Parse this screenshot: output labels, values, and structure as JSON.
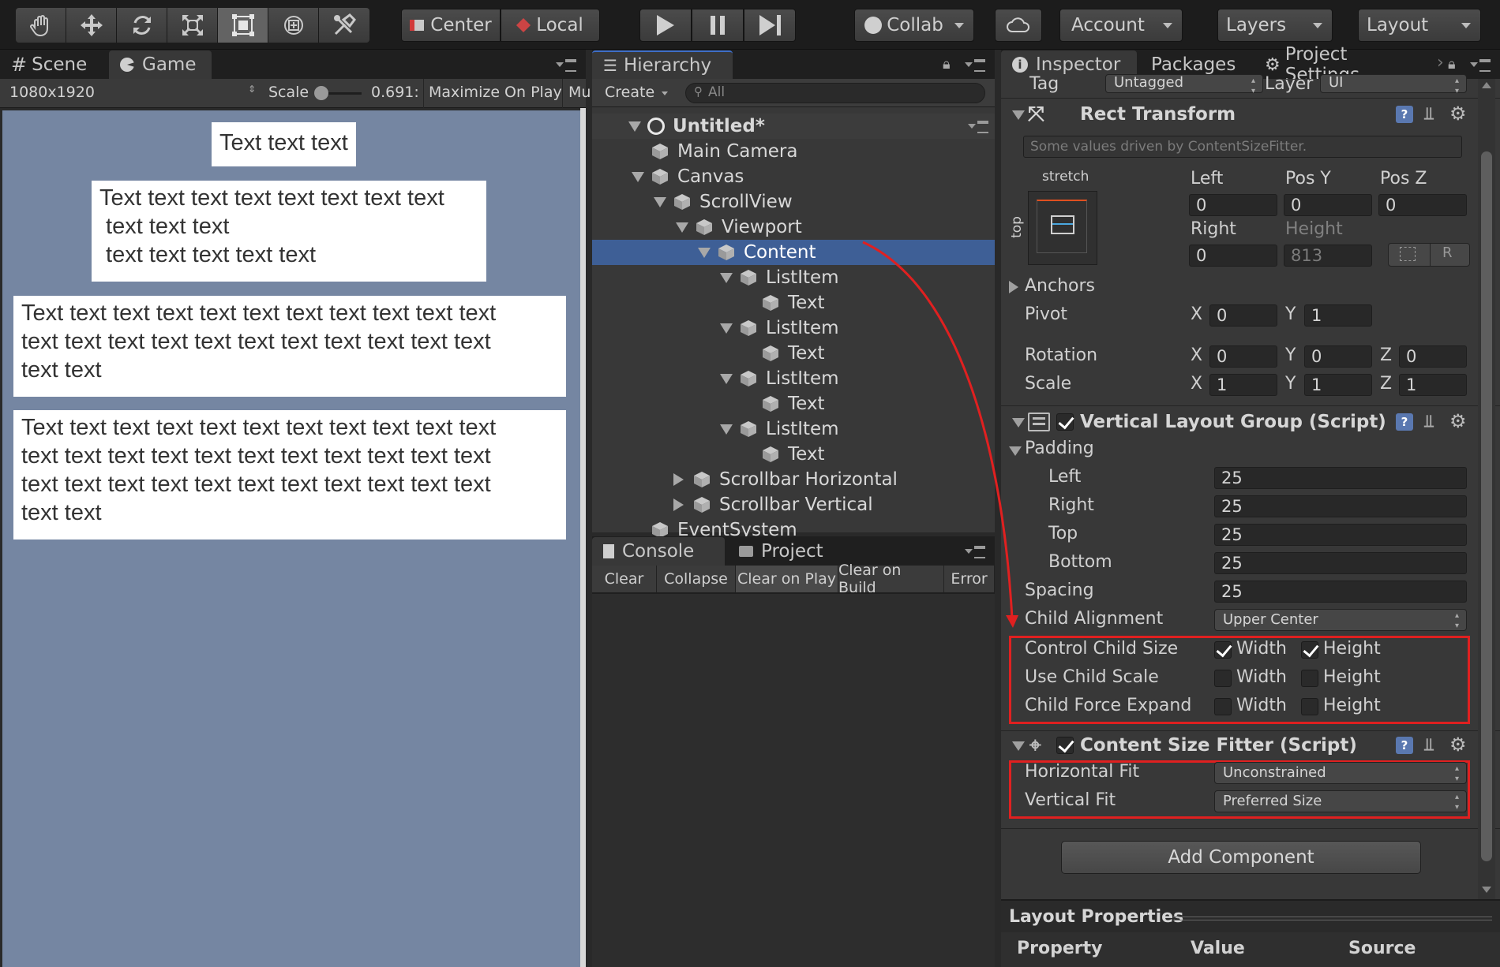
{
  "toolbar": {
    "tools": [
      "hand-tool",
      "move-tool",
      "rotate-tool",
      "scale-tool",
      "rect-tool",
      "transform-tool",
      "custom-tool"
    ],
    "pivot_center": "Center",
    "pivot_local": "Local",
    "collab": "Collab",
    "account": "Account",
    "layers": "Layers",
    "layout": "Layout"
  },
  "game_panel": {
    "tabs": [
      "Scene",
      "Game"
    ],
    "resolution": "1080x1920",
    "scale_label": "Scale",
    "scale_value": "0.691:",
    "maximize": "Maximize On Play",
    "mute": "Mu",
    "cards": [
      "Text text text",
      "Text text text text text text text text\n text text text\n text text text text text",
      "Text text text text text text text text text text text\ntext text text text text text text text text text text\ntext text",
      "Text text text text text text text text text text text\ntext text text text text text text text text text text\ntext text text text text text text text text text text\ntext text"
    ]
  },
  "hierarchy": {
    "tab": "Hierarchy",
    "create": "Create",
    "search_placeholder": "All",
    "scene": "Untitled*",
    "items": [
      "Main Camera",
      "Canvas",
      "ScrollView",
      "Viewport",
      "Content",
      "ListItem",
      "Text",
      "ListItem",
      "Text",
      "ListItem",
      "Text",
      "ListItem",
      "Text",
      "Scrollbar Horizontal",
      "Scrollbar Vertical",
      "EventSystem"
    ]
  },
  "console": {
    "tabs": [
      "Console",
      "Project"
    ],
    "buttons": [
      "Clear",
      "Collapse",
      "Clear on Play",
      "Clear on Build",
      "Error"
    ]
  },
  "inspector": {
    "tabs": [
      "Inspector",
      "Packages",
      "Project Settings"
    ],
    "tag_label": "Tag",
    "tag_value": "Untagged",
    "layer_label": "Layer",
    "layer_value": "UI",
    "rect_transform": {
      "title": "Rect Transform",
      "note": "Some values driven by ContentSizeFitter.",
      "stretch": "stretch",
      "top": "top",
      "left_label": "Left",
      "posy_label": "Pos Y",
      "posz_label": "Pos Z",
      "left": "0",
      "posy": "0",
      "posz": "0",
      "right_label": "Right",
      "height_label": "Height",
      "right": "0",
      "height": "813",
      "r_button": "R",
      "anchors": "Anchors",
      "pivot": "Pivot",
      "pivot_x": "0",
      "pivot_y": "1",
      "rotation": "Rotation",
      "rot_x": "0",
      "rot_y": "0",
      "rot_z": "0",
      "scale": "Scale",
      "scale_x": "1",
      "scale_y": "1",
      "scale_z": "1",
      "x": "X",
      "y": "Y",
      "z": "Z"
    },
    "vlg": {
      "title": "Vertical Layout Group (Script)",
      "padding": "Padding",
      "left_label": "Left",
      "right_label": "Right",
      "top_label": "Top",
      "bottom_label": "Bottom",
      "left": "25",
      "right": "25",
      "top": "25",
      "bottom": "25",
      "spacing_label": "Spacing",
      "spacing": "25",
      "alignment_label": "Child Alignment",
      "alignment": "Upper Center",
      "control_child_size": "Control Child Size",
      "use_child_scale": "Use Child Scale",
      "child_force_expand": "Child Force Expand",
      "width": "Width",
      "height": "Height"
    },
    "csf": {
      "title": "Content Size Fitter (Script)",
      "hfit_label": "Horizontal Fit",
      "hfit": "Unconstrained",
      "vfit_label": "Vertical Fit",
      "vfit": "Preferred Size"
    },
    "add_component": "Add Component",
    "layout_properties": {
      "title": "Layout Properties",
      "columns": [
        "Property",
        "Value",
        "Source"
      ]
    }
  },
  "colors": {
    "selection": "#3e5f96",
    "highlight_box": "#e02020",
    "game_background": "#7586a2"
  }
}
